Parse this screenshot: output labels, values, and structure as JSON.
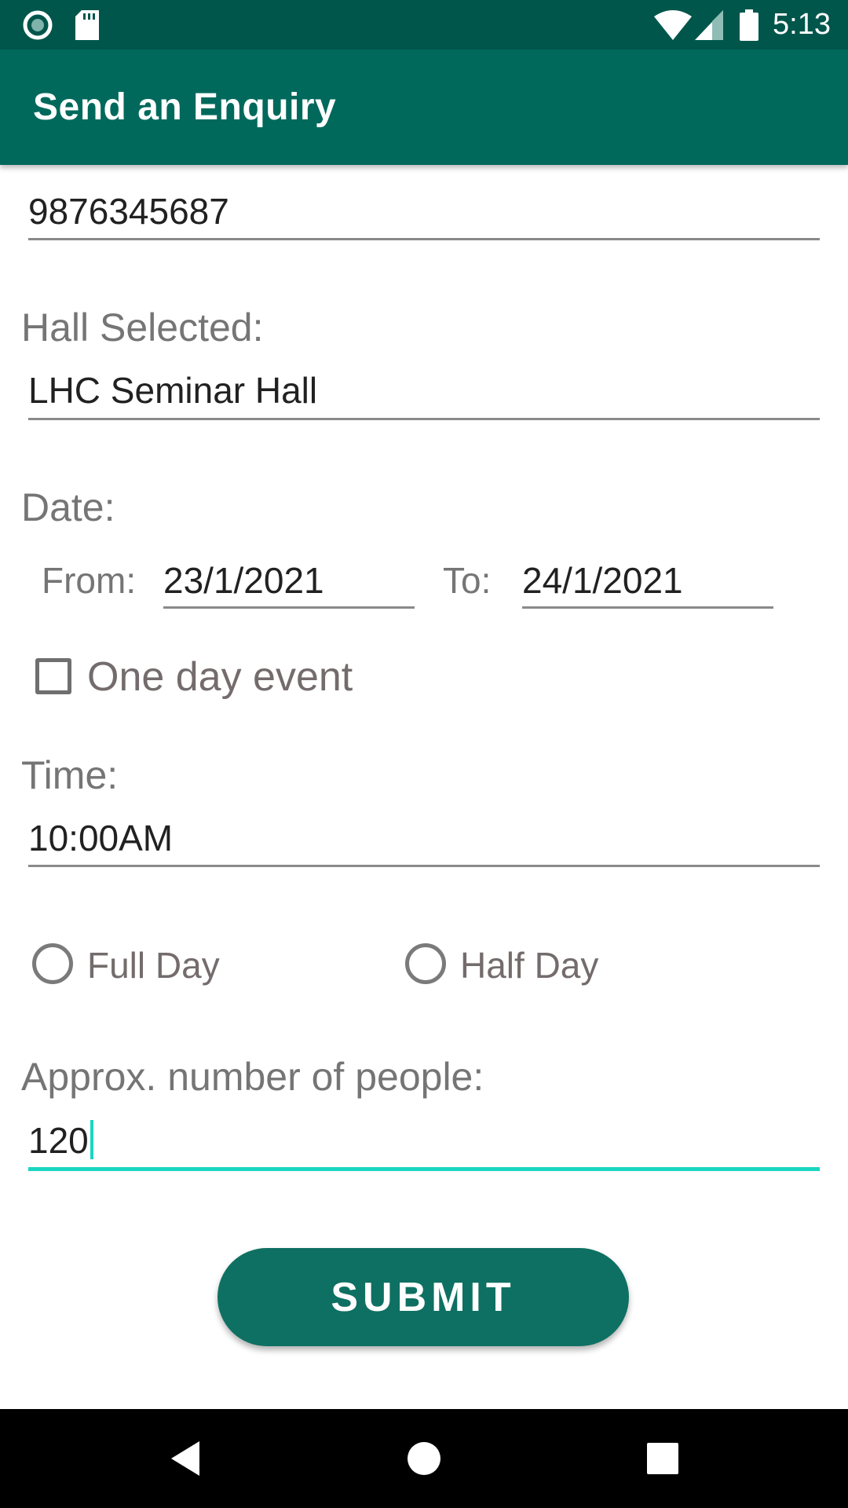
{
  "status_bar": {
    "time": "5:13",
    "icons": [
      "record-icon",
      "sd-card-icon",
      "wifi-icon",
      "cell-signal-icon",
      "battery-icon"
    ]
  },
  "app_bar": {
    "title": "Send an Enquiry"
  },
  "form": {
    "phone_value": "9876345687",
    "hall_label": "Hall Selected:",
    "hall_value": "LHC Seminar Hall",
    "date_label": "Date:",
    "from_label": "From:",
    "from_value": "23/1/2021",
    "to_label": "To:",
    "to_value": "24/1/2021",
    "one_day_label": "One day event",
    "one_day_checked": false,
    "time_label": "Time:",
    "time_value": "10:00AM",
    "duration_options": [
      {
        "label": "Full Day",
        "selected": false
      },
      {
        "label": "Half Day",
        "selected": false
      }
    ],
    "people_label": "Approx. number of people:",
    "people_value": "120",
    "submit_label": "SUBMIT"
  },
  "nav_bar": {
    "icons": [
      "back-icon",
      "home-icon",
      "recents-icon"
    ]
  },
  "colors": {
    "status_bar": "#00564b",
    "app_bar": "#00695c",
    "accent": "#1ad6c0",
    "button": "#0e7062"
  }
}
